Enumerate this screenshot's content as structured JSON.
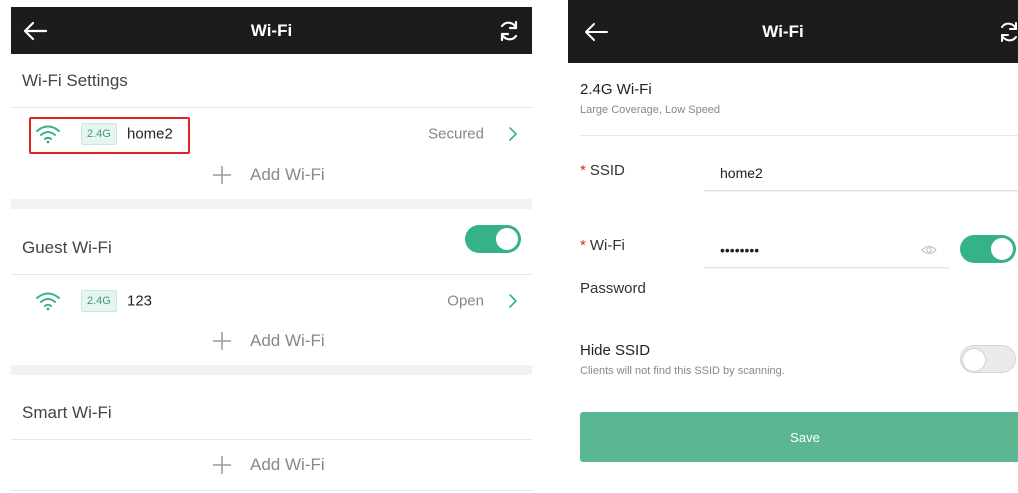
{
  "left": {
    "header": {
      "title": "Wi-Fi",
      "back_icon": "arrow-left-icon",
      "refresh_icon": "refresh-icon"
    },
    "wifi_settings": {
      "title": "Wi-Fi Settings",
      "network": {
        "band": "2.4G",
        "ssid": "home2",
        "status": "Secured"
      },
      "add_label": "Add Wi-Fi"
    },
    "guest_wifi": {
      "title": "Guest Wi-Fi",
      "enabled": true,
      "network": {
        "band": "2.4G",
        "ssid": "123",
        "status": "Open"
      },
      "add_label": "Add Wi-Fi"
    },
    "smart_wifi": {
      "title": "Smart Wi-Fi",
      "add_label": "Add Wi-Fi"
    }
  },
  "right": {
    "header": {
      "title": "Wi-Fi"
    },
    "band": {
      "title": "2.4G Wi-Fi",
      "subtitle": "Large Coverage, Low Speed"
    },
    "ssid": {
      "required_mark": "*",
      "label": "SSID",
      "value": "home2"
    },
    "password": {
      "required_mark": "*",
      "label_line1": "Wi-Fi",
      "label_line2": "Password",
      "value": "••••••••",
      "enabled": true
    },
    "hide_ssid": {
      "title": "Hide SSID",
      "subtitle": "Clients will not find this SSID by scanning.",
      "enabled": false
    },
    "save_label": "Save"
  },
  "colors": {
    "header_bg": "#1c1c1c",
    "accent": "#35b288",
    "save_bg": "#5ab792",
    "highlight": "#e02424"
  }
}
